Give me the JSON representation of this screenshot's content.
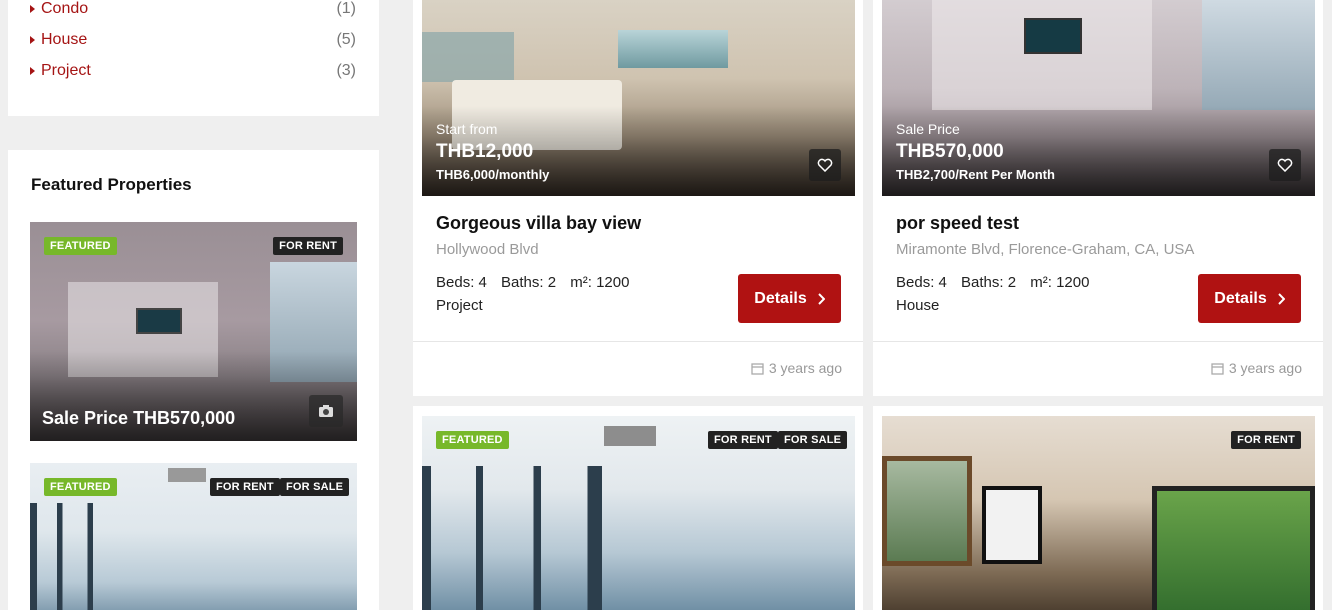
{
  "sidebar": {
    "categories": [
      {
        "label": "Condo",
        "count": "(1)"
      },
      {
        "label": "House",
        "count": "(5)"
      },
      {
        "label": "Project",
        "count": "(3)"
      }
    ],
    "featured": {
      "title": "Featured Properties",
      "items": [
        {
          "badge_left": "FEATURED",
          "badge_right": [
            "FOR RENT"
          ],
          "price": "Sale Price THB570,000"
        },
        {
          "badge_left": "FEATURED",
          "badge_right": [
            "FOR RENT",
            "FOR SALE"
          ]
        }
      ]
    }
  },
  "listings": [
    {
      "price_label": "Start from",
      "price": "THB12,000",
      "price_sub": "THB6,000/monthly",
      "title": "Gorgeous villa bay view",
      "address": "Hollywood Blvd",
      "beds": "Beds: 4",
      "baths": "Baths: 2",
      "area": "m²: 1200",
      "type": "Project",
      "details": "Details",
      "ago": "3 years ago"
    },
    {
      "price_label": "Sale Price",
      "price": "THB570,000",
      "price_sub": "THB2,700/Rent Per Month",
      "title": "por speed test",
      "address": "Miramonte Blvd, Florence-Graham, CA, USA",
      "beds": "Beds: 4",
      "baths": "Baths: 2",
      "area": "m²: 1200",
      "type": "House",
      "details": "Details",
      "ago": "3 years ago"
    },
    {
      "badge_left": "FEATURED",
      "badges_right": [
        "FOR RENT",
        "FOR SALE"
      ]
    },
    {
      "badges_right": [
        "FOR RENT"
      ]
    }
  ],
  "colors": {
    "accent": "#b01212",
    "link": "#a51414",
    "featured_badge": "#77b82a"
  }
}
